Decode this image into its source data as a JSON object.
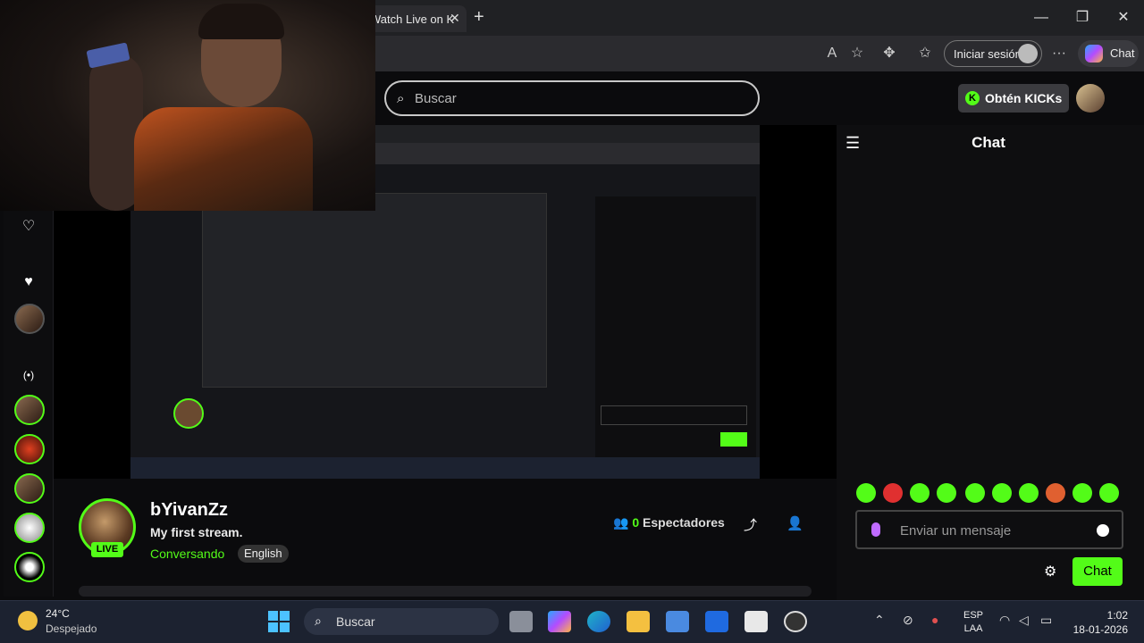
{
  "browser": {
    "tab_title": "Watch Live on K",
    "new_tab": "+",
    "signin_label": "Iniciar sesión",
    "chat_label": "Chat",
    "window_controls": [
      "—",
      "❐",
      "✕"
    ]
  },
  "kick": {
    "search_placeholder": "Buscar",
    "get_kicks": "Obtén KICKs",
    "chat_title": "Chat",
    "message_placeholder": "Enviar un mensaje",
    "send_label": "Chat"
  },
  "streamer": {
    "name": "bYivanZz",
    "live": "LIVE",
    "title": "My first stream.",
    "category": "Conversando",
    "language": "English",
    "viewers_count": "0",
    "viewers_label": "Espectadores"
  },
  "taskbar": {
    "temperature": "24°C",
    "weather": "Despejado",
    "search": "Buscar",
    "lang_top": "ESP",
    "lang_bottom": "LAA",
    "time": "1:02",
    "date": "18-01-2026"
  },
  "icons": {
    "heart": "♥",
    "broadcast": "(•)",
    "collapse": "≡→",
    "share": "⤴",
    "gear": "⚙",
    "search": "⌕"
  },
  "colors": {
    "brand_green": "#53fc18",
    "bg": "#0b0b0d",
    "taskbar": "#1c2230"
  }
}
